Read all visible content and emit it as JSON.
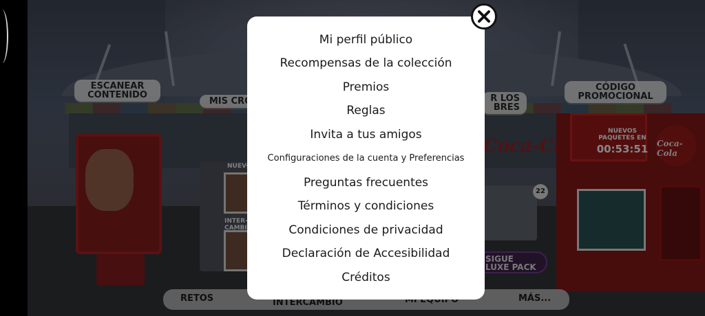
{
  "scene": {
    "signs": {
      "scan": "ESCANEAR\nCONTENIDO",
      "my_cromos": "MIS CRO",
      "names_partial": "R LOS\nBRES",
      "promo_code": "CÓDIGO\nPROMOCIONAL"
    },
    "kiosk": {
      "new_packs_label": "NUEVOS\nPAQUETES EN",
      "countdown": "00:53:51"
    },
    "brand_text": "Coca-Cola",
    "brand_text_2": "Coca-Cola",
    "stack_labels": {
      "top": "NUEVO",
      "middle": "INTER-\nCAMBIA"
    },
    "badge_number": "22",
    "deluxe_pill": "SIGUE\nLUXE PACK",
    "bottom_nav": {
      "retos": "RETOS",
      "intercambio": "INTERCAMBIO",
      "mi_equipo_partial": "MI EQUIPO",
      "mas": "MÁS..."
    }
  },
  "menu": {
    "items": [
      "Mi perfil público",
      "Recompensas de la colección",
      "Premios",
      "Reglas",
      "Invita a tus amigos",
      "Configuraciones de la cuenta y Preferencias",
      "Preguntas frecuentes",
      "Términos y condiciones",
      "Condiciones de privacidad",
      "Declaración de Accesibilidad",
      "Créditos"
    ],
    "close_icon": "close-icon"
  },
  "colors": {
    "modal_bg": "#ffffff",
    "text": "#1a1a1a",
    "brand_red": "#b32020"
  }
}
